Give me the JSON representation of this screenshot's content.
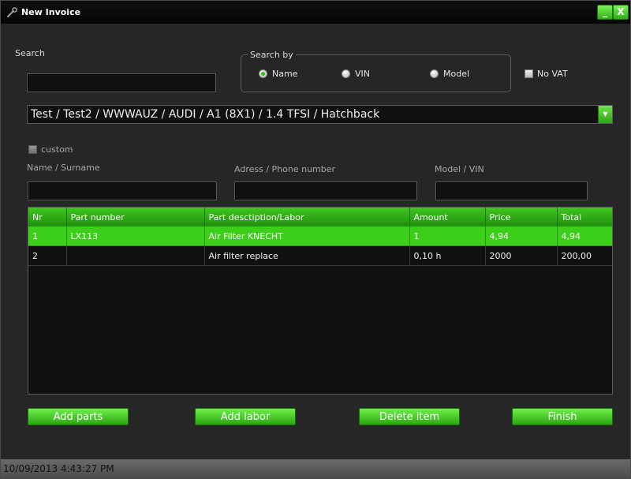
{
  "window": {
    "title": "New Invoice"
  },
  "titlebar_buttons": {
    "minimize": "_",
    "close": "X"
  },
  "search": {
    "label": "Search",
    "value": ""
  },
  "search_by": {
    "legend": "Search by",
    "options": [
      {
        "label": "Name",
        "selected": true
      },
      {
        "label": "VIN",
        "selected": false
      },
      {
        "label": "Model",
        "selected": false
      }
    ]
  },
  "no_vat": {
    "label": "No VAT",
    "checked": false
  },
  "vehicle_combo": {
    "value": "Test / Test2 / WWWAUZ / AUDI / A1 (8X1) / 1.4 TFSI / Hatchback"
  },
  "custom": {
    "label": "custom",
    "checked": false
  },
  "fields": {
    "name_label": "Name / Surname",
    "address_label": "Adress / Phone number",
    "model_label": "Model / VIN",
    "name_value": "",
    "address_value": "",
    "model_value": ""
  },
  "table": {
    "columns": [
      "Nr",
      "Part number",
      "Part desctiption/Labor",
      "Amount",
      "Price",
      "Total"
    ],
    "rows": [
      {
        "nr": "1",
        "part_number": "LX113",
        "description": "Air Filter KNECHT",
        "amount": "1",
        "price": "4,94",
        "total": "4,94",
        "selected": true
      },
      {
        "nr": "2",
        "part_number": "",
        "description": "Air filter replace",
        "amount": "0,10 h",
        "price": "2000",
        "total": "200,00",
        "selected": false
      }
    ]
  },
  "actions": {
    "add_parts": "Add parts",
    "add_labor": "Add labor",
    "delete_item": "Delete item",
    "finish": "Finish"
  },
  "status": {
    "datetime": "10/09/2013 4:43:27 PM"
  },
  "colors": {
    "accent": "#3ccf1a",
    "background": "#262626",
    "field": "#111111"
  }
}
